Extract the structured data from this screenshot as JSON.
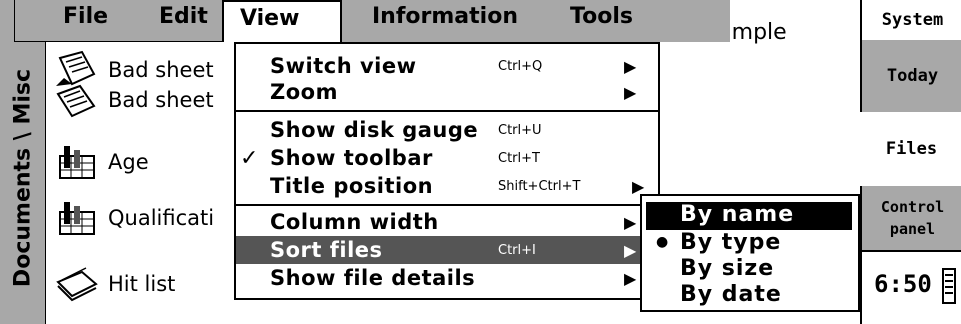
{
  "menubar": {
    "file": "File",
    "edit": "Edit",
    "view": "View",
    "information": "Information",
    "tools": "Tools"
  },
  "folder_path": "Documents \\ Misc",
  "example_text": "example",
  "files": [
    {
      "label": "Bad sheet",
      "icon": "note-sheet-icon"
    },
    {
      "label": "Age",
      "icon": "spreadsheet-chart-icon"
    },
    {
      "label": "Qualificati",
      "icon": "spreadsheet-chart-icon"
    },
    {
      "label": "Hit list",
      "icon": "card-file-icon"
    }
  ],
  "view_menu": [
    {
      "label": "Switch view",
      "shortcut": "Ctrl+Q",
      "arrow": "▶",
      "check": ""
    },
    {
      "label": "Zoom",
      "shortcut": "",
      "arrow": "▶",
      "check": ""
    },
    {
      "label": "Show disk gauge",
      "shortcut": "Ctrl+U",
      "arrow": "",
      "check": ""
    },
    {
      "label": "Show toolbar",
      "shortcut": "Ctrl+T",
      "arrow": "",
      "check": "✓"
    },
    {
      "label": "Title position",
      "shortcut": "Shift+Ctrl+T",
      "arrow": "▶",
      "check": ""
    },
    {
      "label": "Column width",
      "shortcut": "",
      "arrow": "▶",
      "check": ""
    },
    {
      "label": "Sort files",
      "shortcut": "Ctrl+I",
      "arrow": "▶",
      "check": "",
      "highlighted": true
    },
    {
      "label": "Show file details",
      "shortcut": "",
      "arrow": "▶",
      "check": ""
    }
  ],
  "sort_submenu": [
    {
      "label": "By name",
      "selected": false,
      "highlighted": true
    },
    {
      "label": "By type",
      "selected": true,
      "mark": "●"
    },
    {
      "label": "By size",
      "selected": false
    },
    {
      "label": "By date",
      "selected": false
    }
  ],
  "sidebar": {
    "system": "System",
    "today": "Today",
    "files": "Files",
    "control_panel": "Control panel",
    "clock": "6:50"
  },
  "colors": {
    "menubar_gray": "#a8a8a8",
    "highlight_gray": "#555555",
    "selection_black": "#000000"
  }
}
